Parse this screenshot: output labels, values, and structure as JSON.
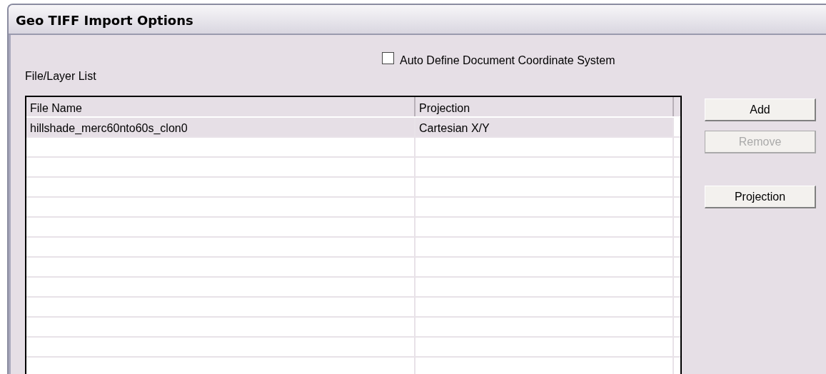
{
  "window": {
    "title": "Geo TIFF Import Options"
  },
  "auto_define": {
    "label": "Auto Define Document Coordinate System",
    "checked": false
  },
  "list_label": "File/Layer List",
  "table": {
    "columns": [
      "File Name",
      "Projection"
    ],
    "rows": [
      {
        "cells": [
          "hillshade_merc60nto60s_clon0",
          "Cartesian X/Y"
        ],
        "selected": true
      }
    ]
  },
  "buttons": [
    {
      "label": "Add",
      "disabled": false
    },
    {
      "label": "Remove",
      "disabled": true
    },
    {
      "label": "Projection",
      "disabled": false
    }
  ]
}
